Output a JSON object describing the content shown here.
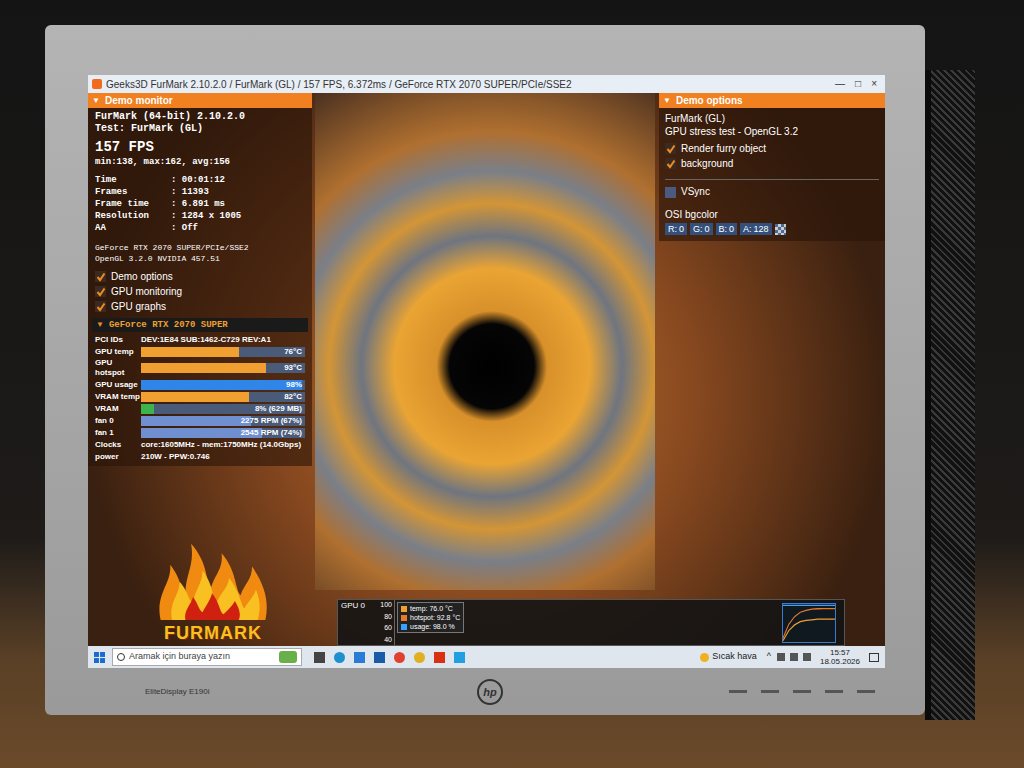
{
  "window": {
    "title": "Geeks3D FurMark 2.10.2.0 / FurMark (GL) / 157 FPS, 6.372ms / GeForce RTX 2070 SUPER/PCIe/SSE2",
    "controls": [
      "—",
      "□",
      "×"
    ]
  },
  "demo_monitor": {
    "expander": "▼",
    "header": "Demo monitor",
    "app": "FurMark (64-bit) 2.10.2.0",
    "test": "Test: FurMark (GL)",
    "fps": "157 FPS",
    "fps_stats": "min:138, max:162, avg:156",
    "stats": [
      {
        "label": "Time",
        "value": ": 00:01:12"
      },
      {
        "label": "Frames",
        "value": ": 11393"
      },
      {
        "label": "Frame time",
        "value": ": 6.891 ms"
      },
      {
        "label": "Resolution",
        "value": ": 1284 x 1005"
      },
      {
        "label": "AA",
        "value": ": Off"
      }
    ],
    "gpu": "GeForce RTX 2070 SUPER/PCIe/SSE2",
    "opengl": "OpenGL 3.2.0 NVIDIA 457.51",
    "checkboxes": [
      {
        "label": "Demo options",
        "checked": true
      },
      {
        "label": "GPU monitoring",
        "checked": true
      },
      {
        "label": "GPU graphs",
        "checked": true
      }
    ]
  },
  "gpu_section": {
    "expander": "▼",
    "header": "GeForce RTX 2070 SUPER",
    "pci": {
      "label": "PCI IDs",
      "value": "DEV:1E84 SUB:1462-C729 REV:A1"
    },
    "rows": [
      {
        "label": "GPU temp",
        "reading": "76°C",
        "level": 0.6,
        "color": "#f0a030"
      },
      {
        "label": "GPU hotspot",
        "reading": "93°C",
        "level": 0.76,
        "color": "#f0a030"
      },
      {
        "label": "GPU usage",
        "reading": "98%",
        "level": 0.98,
        "color": "#2f86e8"
      },
      {
        "label": "VRAM temp",
        "reading": "82°C",
        "level": 0.66,
        "color": "#f0a030"
      },
      {
        "label": "VRAM",
        "reading": "8% (629 MB)",
        "level": 0.08,
        "color": "#3cb44b"
      },
      {
        "label": "fan 0",
        "reading": "2275 RPM (67%)",
        "level": 0.67,
        "color": "#6f8fd0"
      },
      {
        "label": "fan 1",
        "reading": "2545 RPM (74%)",
        "level": 0.74,
        "color": "#6f8fd0"
      }
    ],
    "clocks": {
      "label": "Clocks",
      "value": "core:1605MHz - mem:1750MHz (14.0Gbps)"
    },
    "power": {
      "label": "power",
      "value": "210W - PPW:0.746"
    }
  },
  "demo_options": {
    "expander": "▼",
    "header": "Demo options",
    "title": "FurMark (GL)",
    "subtitle": "GPU stress test - OpenGL 3.2",
    "checkboxes": [
      {
        "label": "Render furry object",
        "checked": true
      },
      {
        "label": "background",
        "checked": true
      },
      {
        "label": "VSync",
        "checked": false
      }
    ],
    "bgcolor_label": "OSI bgcolor",
    "channels": [
      {
        "label": "R:",
        "value": "0"
      },
      {
        "label": "G:",
        "value": "0"
      },
      {
        "label": "B:",
        "value": "0"
      },
      {
        "label": "A:",
        "value": "128"
      }
    ]
  },
  "graph": {
    "label": "GPU 0",
    "ticks": [
      "100",
      "80",
      "60",
      "40"
    ],
    "legend": [
      {
        "text": "temp: 76.0 °C",
        "color": "#f0a030",
        "values": [
          42,
          58,
          67,
          72,
          74,
          75,
          76,
          76,
          76,
          76
        ]
      },
      {
        "text": "hotspot: 92.8 °C",
        "color": "#e8782a",
        "values": [
          46,
          68,
          80,
          87,
          90,
          92,
          92.5,
          92.8,
          92.8,
          92.8
        ]
      },
      {
        "text": "usage: 98.0 %",
        "color": "#3aa0ff",
        "values": [
          98,
          98,
          98,
          98,
          98,
          98,
          98,
          98,
          98,
          98
        ]
      }
    ]
  },
  "logo": "FURMARK",
  "taskbar": {
    "search_placeholder": "Aramak için buraya yazın",
    "weather": "Sıcak hava",
    "tray": "^",
    "time": "15:57",
    "date": "18.05.2026"
  },
  "monitor": {
    "brand": "hp",
    "model": "EliteDisplay E190i"
  }
}
